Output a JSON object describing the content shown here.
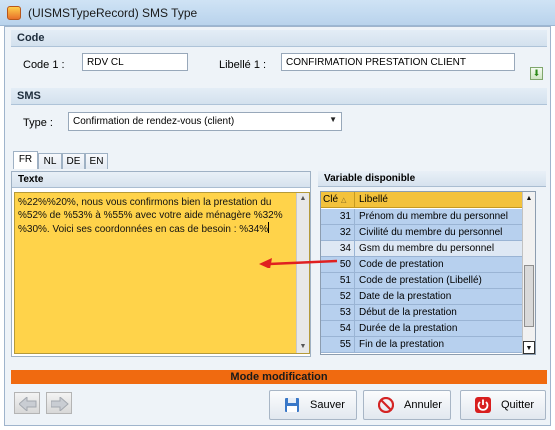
{
  "window": {
    "title": "(UISMSTypeRecord) SMS Type"
  },
  "code_section": {
    "header": "Code",
    "code_label": "Code 1 :",
    "code_value": "RDV CL",
    "libelle_label": "Libellé 1 :",
    "libelle_value": "CONFIRMATION PRESTATION CLIENT"
  },
  "sms_section": {
    "header": "SMS",
    "type_label": "Type :",
    "type_value": "Confirmation de rendez-vous (client)"
  },
  "tabs": [
    "FR",
    "NL",
    "DE",
    "EN"
  ],
  "texte": {
    "header": "Texte",
    "lines": [
      "%22%%20%, nous vous confirmons bien la prestation du",
      "%52% de %53% à %55% avec votre aide ménagère %32%",
      "%30%. Voici ses coordonnées en cas de besoin : %34%"
    ]
  },
  "variables": {
    "header": "Variable disponible",
    "col_cle": "Clé",
    "col_libelle": "Libellé",
    "rows": [
      {
        "cle": "31",
        "libelle": "Prénom du membre du personnel",
        "selected": false
      },
      {
        "cle": "32",
        "libelle": "Civilité du membre du personnel",
        "selected": false
      },
      {
        "cle": "34",
        "libelle": "Gsm du membre du personnel",
        "selected": true
      },
      {
        "cle": "50",
        "libelle": "Code de prestation",
        "selected": false
      },
      {
        "cle": "51",
        "libelle": "Code de prestation (Libellé)",
        "selected": false
      },
      {
        "cle": "52",
        "libelle": "Date de la prestation",
        "selected": false
      },
      {
        "cle": "53",
        "libelle": "Début de la prestation",
        "selected": false
      },
      {
        "cle": "54",
        "libelle": "Durée de la prestation",
        "selected": false
      },
      {
        "cle": "55",
        "libelle": "Fin de la prestation",
        "selected": false
      }
    ]
  },
  "status": "Mode modification",
  "buttons": {
    "save": "Sauver",
    "cancel": "Annuler",
    "quit": "Quitter"
  },
  "colors": {
    "text_area": "#ffd34a",
    "status_bar": "#f06a10",
    "grid_header": "#f3c23c",
    "grid_row": "#b7d0ee",
    "arrow": "#e02020"
  },
  "icons": [
    "app-icon",
    "sort-asc-icon",
    "scroll-up-icon",
    "scroll-down-icon",
    "arrow-left-icon",
    "arrow-right-icon",
    "save-icon",
    "cancel-icon",
    "power-icon",
    "add-icon"
  ]
}
